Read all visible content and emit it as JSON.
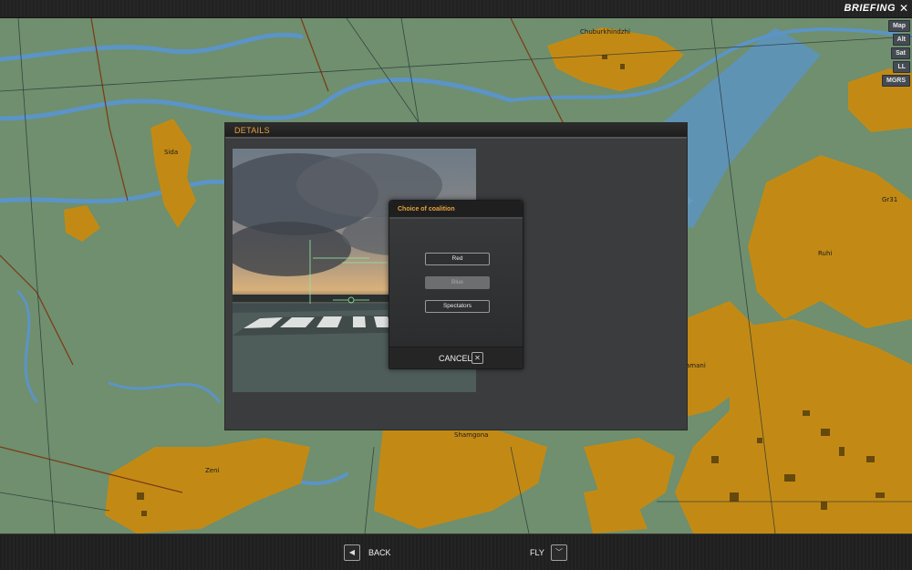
{
  "topbar": {
    "title": "BRIEFING",
    "close_icon": "close-icon"
  },
  "map": {
    "town_labels": [
      "Chuburkhindzhi",
      "Sida",
      "Gr31",
      "Ruhi",
      "Zeni",
      "Shamgona",
      "amani"
    ],
    "colors": {
      "land": "#6f8f6e",
      "urban": "#c28a15",
      "river": "#5b94c6",
      "road": "#7a3a14"
    },
    "layer_buttons": [
      "Map",
      "Alt",
      "Sat",
      "LL",
      "MGRS"
    ]
  },
  "details": {
    "title": "DETAILS"
  },
  "modal": {
    "title": "Choice of coalition",
    "options": [
      {
        "label": "Red",
        "state": "enabled"
      },
      {
        "label": "Blue",
        "state": "disabled"
      },
      {
        "label": "Spectators",
        "state": "enabled"
      }
    ],
    "cancel_label": "CANCEL",
    "cancel_icon": "close-icon"
  },
  "bottombar": {
    "back_label": "BACK",
    "back_icon": "left-arrow-icon",
    "fly_label": "FLY",
    "fly_icon": "chevron-down-icon"
  },
  "colors": {
    "accent": "#e7a23d"
  }
}
